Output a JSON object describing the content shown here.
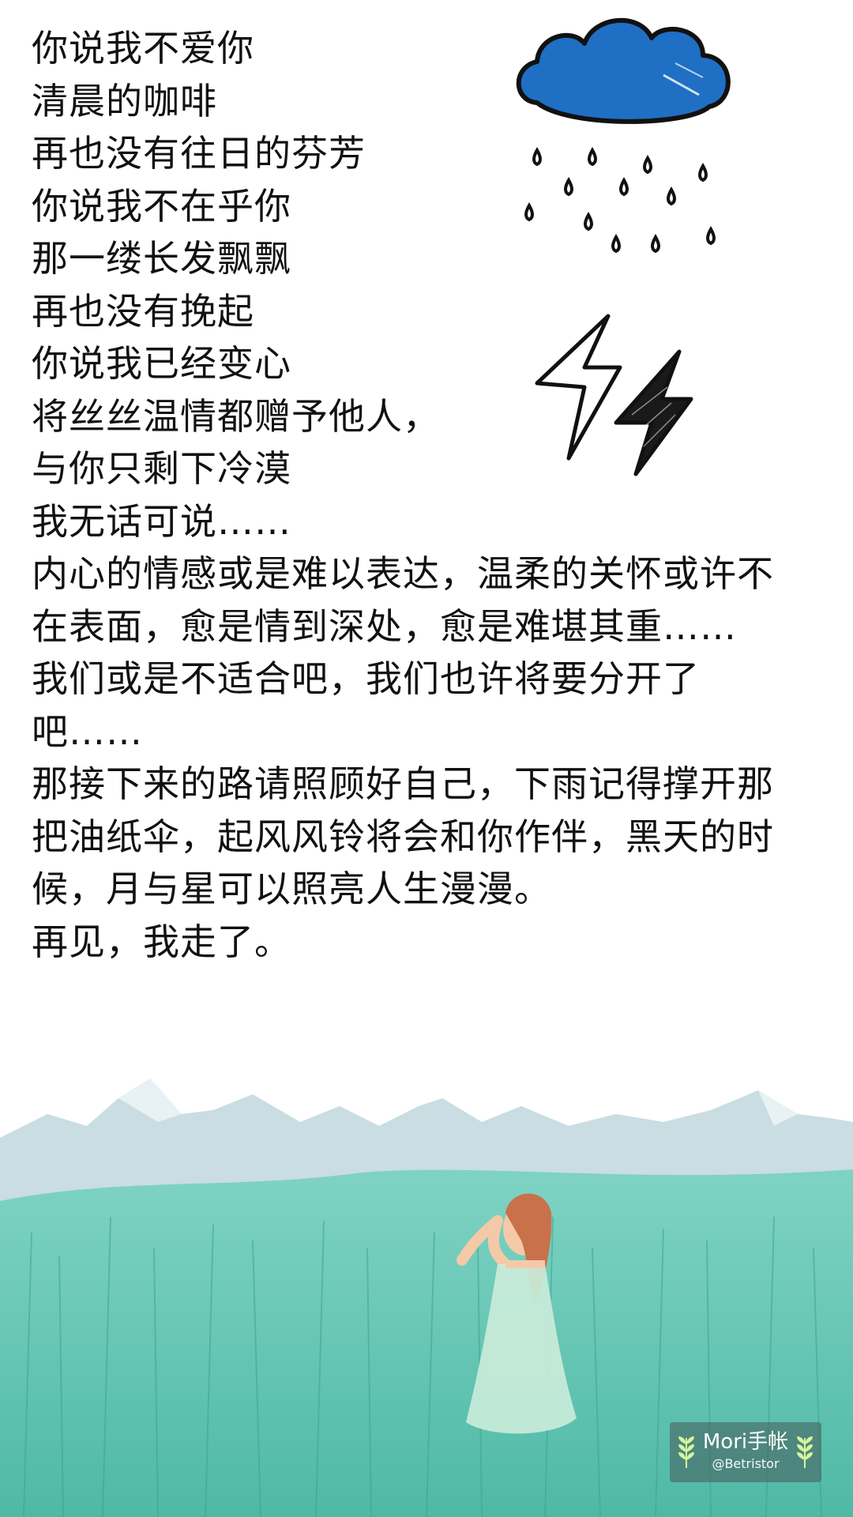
{
  "poem": {
    "lines": [
      "你说我不爱你",
      "清晨的咖啡",
      "再也没有往日的芬芳",
      "你说我不在乎你",
      "那一缕长发飘飘",
      "再也没有挽起",
      "你说我已经变心",
      "将丝丝温情都赠予他人，",
      "与你只剩下冷漠",
      "我无话可说……",
      "内心的情感或是难以表达，温柔的关怀或许不",
      "在表面，愈是情到深处，愈是难堪其重……",
      "我们或是不适合吧，我们也许将要分开了",
      "吧……",
      "那接下来的路请照顾好自己，下雨记得撑开那",
      "把油纸伞，起风风铃将会和你作伴，黑天的时",
      "候，月与星可以照亮人生漫漫。",
      "再见，我走了。"
    ]
  },
  "watermark": {
    "brand": "Mori手帐",
    "handle": "@Betristor"
  },
  "illustrations": {
    "cloud": "rain-cloud-icon",
    "lightning": "lightning-bolt-icon",
    "meadow": "girl-in-meadow-illustration"
  },
  "colors": {
    "cloud_blue": "#1f6fc4",
    "grass_teal": "#62c8b4",
    "mountain_gray": "#c9dde2",
    "text": "#111111"
  }
}
